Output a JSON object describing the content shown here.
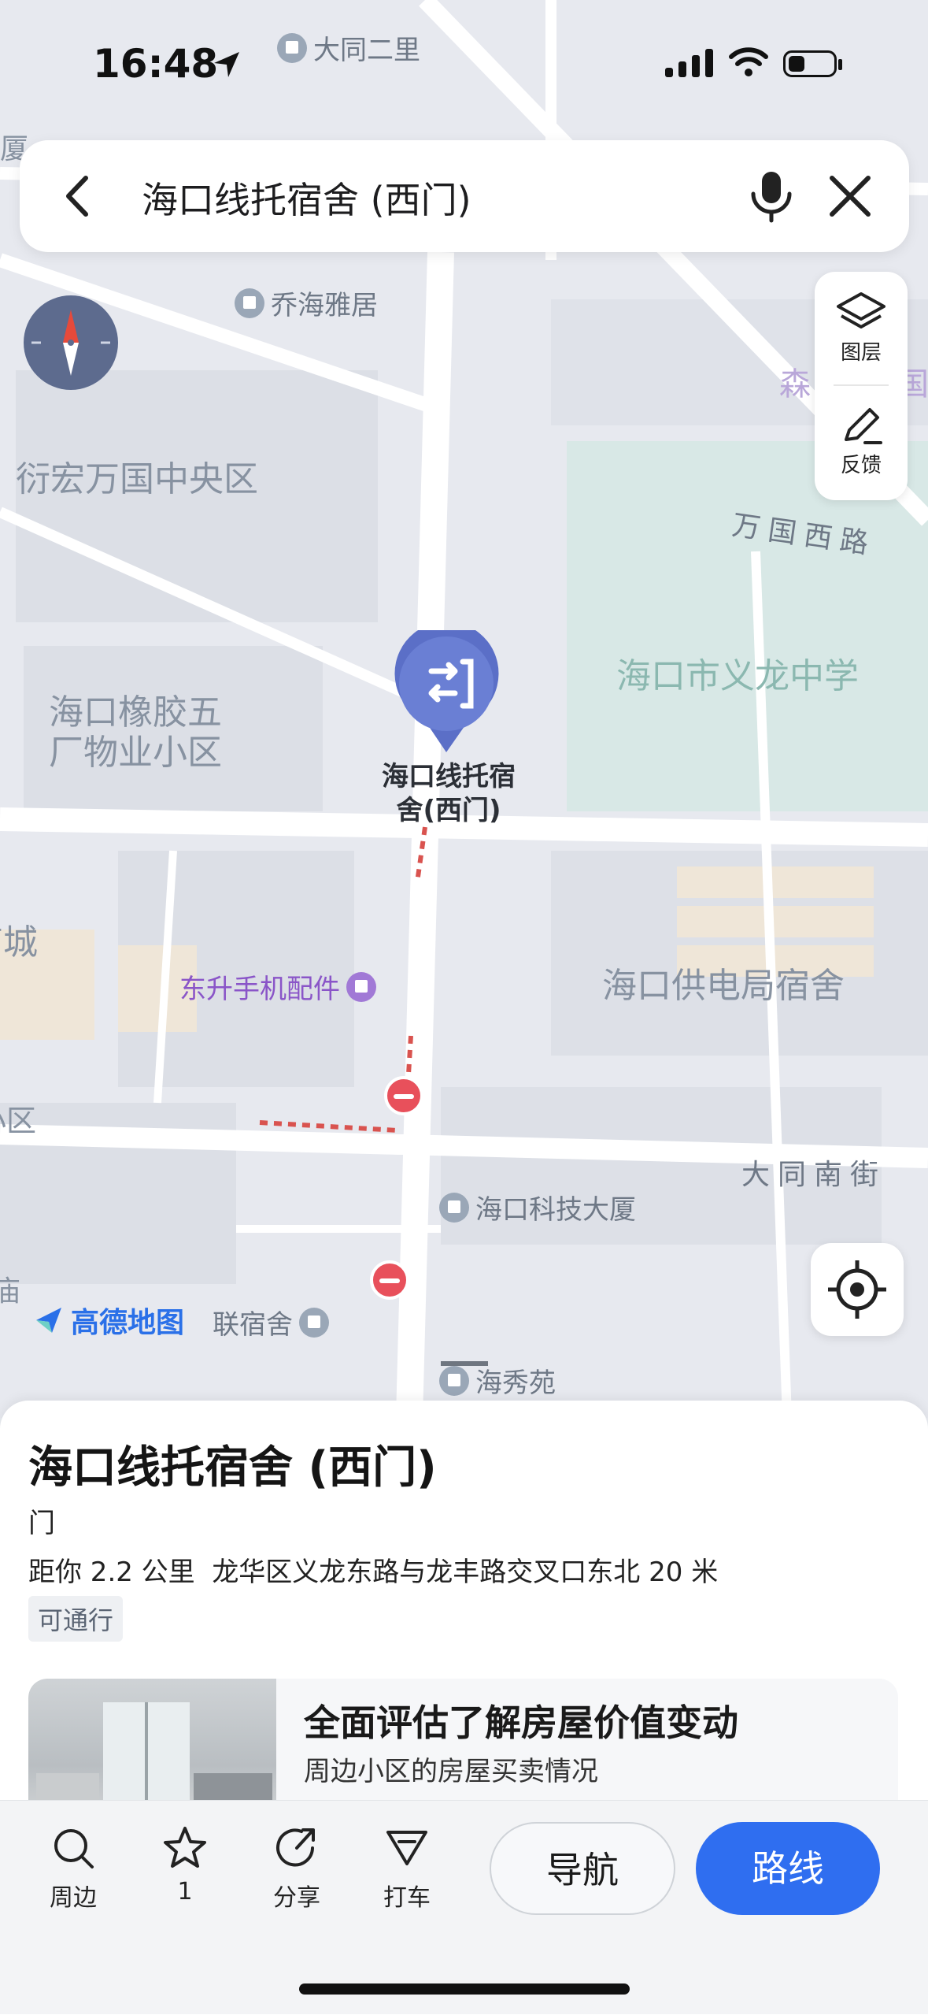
{
  "status": {
    "time": "16:48"
  },
  "search": {
    "query": "海口线托宿舍 (西门)"
  },
  "map_labels": {
    "datong_erli": "大同二里",
    "qiaohai_yaju": "乔海雅居",
    "yanhong_wanguo": "衍宏万国中央区",
    "wanguo_xilu": "万国西路",
    "yilong_school": "海口市义龙中学",
    "rubber_five": "海口橡胶五\n厂物业小区",
    "dongsheng_phone": "东升手机配件",
    "power_dorm": "海口供电局宿舍",
    "datong_nanjie": "大同南街",
    "tech_building": "海口科技大厦",
    "lian_dorm": "联宿舍",
    "haixiuyuan": "海秀苑",
    "edge_xia": "厦",
    "edge_sen": "森",
    "edge_guo": "国",
    "edge_cheng": "商城",
    "edge_xiaoqu": "小区",
    "edge_miao": "庙"
  },
  "pin": {
    "label": "海口线托宿\n舍(西门)"
  },
  "tools": {
    "layers": "图层",
    "feedback": "反馈"
  },
  "logo": {
    "text": "高德地图"
  },
  "place": {
    "name": "海口线托宿舍 (西门)",
    "category": "门",
    "distance": "距你 2.2 公里",
    "address": "龙华区义龙东路与龙丰路交叉口东北 20 米",
    "badge": "可通行"
  },
  "promo": {
    "title": "全面评估了解房屋价值变动",
    "subtitle": "周边小区的房屋买卖情况"
  },
  "bottom_bar": {
    "nearby": "周边",
    "favorite_count": "1",
    "share": "分享",
    "taxi": "打车",
    "navigate": "导航",
    "route": "路线"
  },
  "colors": {
    "accent": "#2f6ef0",
    "pin": "#5b6fc7",
    "no_entry": "#e8505b"
  }
}
